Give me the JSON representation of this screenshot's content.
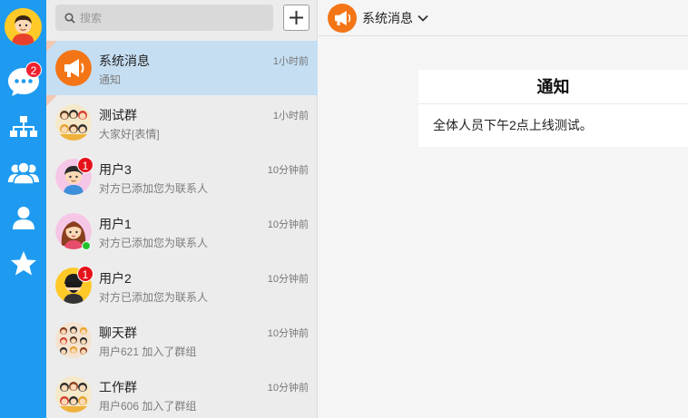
{
  "nav": {
    "message_badge": "2",
    "icons": [
      "chat-icon",
      "org-chart-icon",
      "group-icon",
      "contacts-icon",
      "favorites-icon"
    ]
  },
  "search": {
    "placeholder": "搜索"
  },
  "conversations": [
    {
      "name": "系统消息",
      "time": "1小时前",
      "preview": "通知"
    },
    {
      "name": "测试群",
      "time": "1小时前",
      "preview": "大家好[表情]"
    },
    {
      "name": "用户3",
      "time": "10分钟前",
      "preview": "对方已添加您为联系人",
      "badge": "1"
    },
    {
      "name": "用户1",
      "time": "10分钟前",
      "preview": "对方已添加您为联系人"
    },
    {
      "name": "用户2",
      "time": "10分钟前",
      "preview": "对方已添加您为联系人",
      "badge": "1"
    },
    {
      "name": "聊天群",
      "time": "10分钟前",
      "preview": "用户621 加入了群组"
    },
    {
      "name": "工作群",
      "time": "10分钟前",
      "preview": "用户606 加入了群组"
    }
  ],
  "chat": {
    "title": "系统消息",
    "notice_title": "通知",
    "notice_body": "全体人员下午2点上线测试。"
  },
  "colors": {
    "nav_bg": "#1e9bf0",
    "active_row": "#c5def2",
    "system_orange": "#f47516",
    "badge_red": "#e5121c",
    "online_green": "#21c42d"
  }
}
